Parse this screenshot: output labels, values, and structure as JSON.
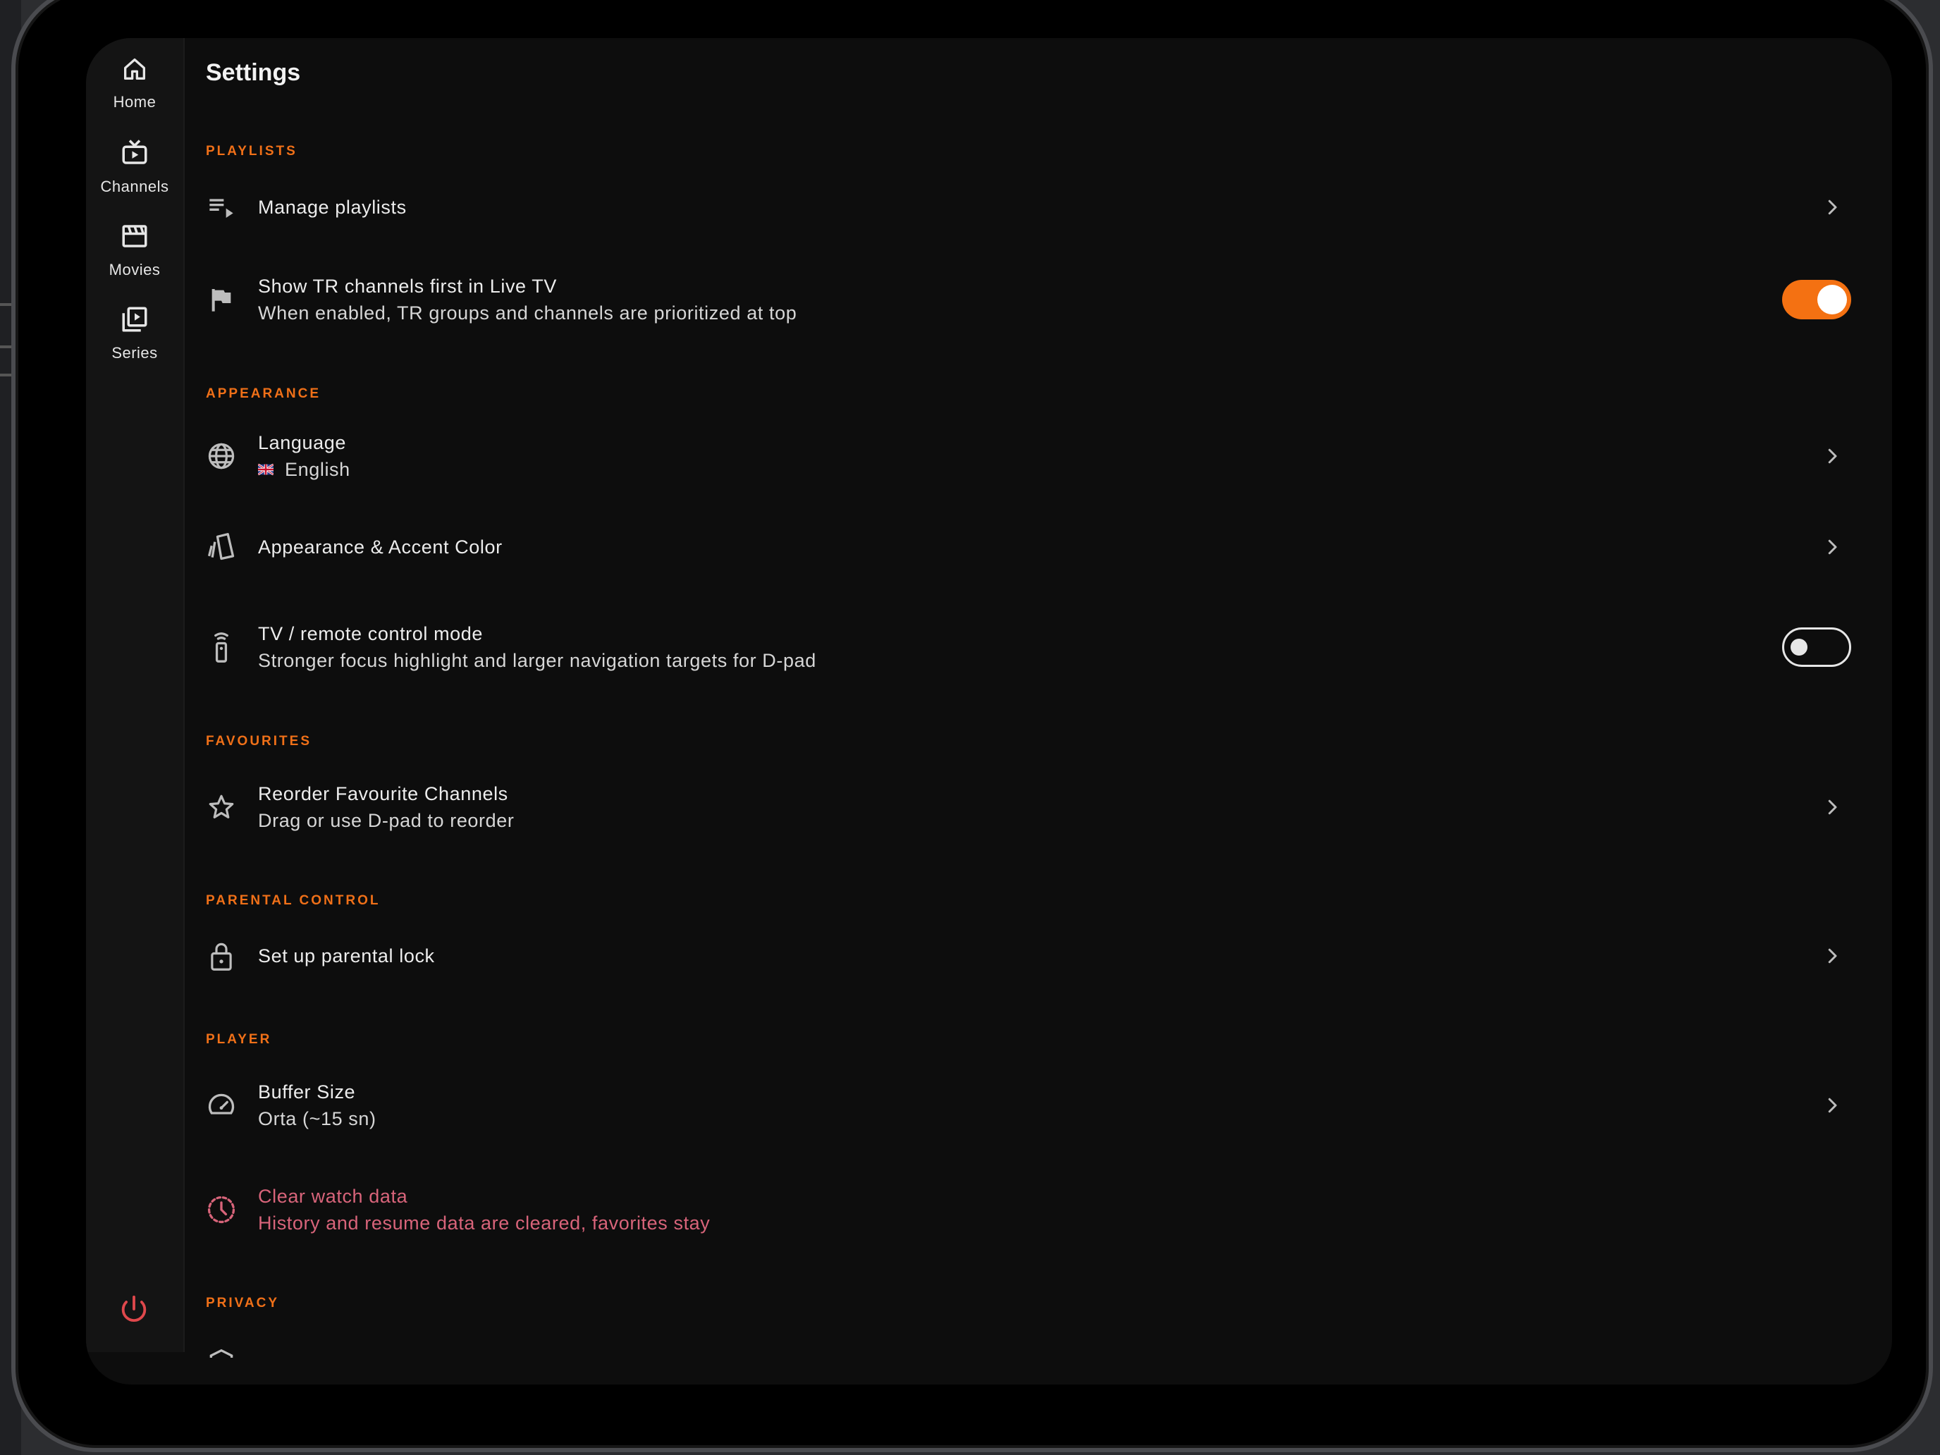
{
  "nav": {
    "items": [
      {
        "label": "Home",
        "icon": "home-icon"
      },
      {
        "label": "Channels",
        "icon": "tv-icon"
      },
      {
        "label": "Movies",
        "icon": "clapperboard-icon"
      },
      {
        "label": "Series",
        "icon": "video-library-icon"
      }
    ],
    "power_icon": "power-icon"
  },
  "page": {
    "title": "Settings"
  },
  "sections": {
    "playlists": {
      "label": "PLAYLISTS",
      "manage": {
        "title": "Manage playlists",
        "icon": "playlist-play-icon"
      },
      "tr_first": {
        "title": "Show TR channels first in Live TV",
        "subtitle": "When enabled, TR groups and channels are prioritized at top",
        "icon": "flag-icon",
        "enabled": true
      }
    },
    "appearance": {
      "label": "APPEARANCE",
      "language": {
        "title": "Language",
        "value": "English",
        "icon": "globe-icon",
        "flag_icon": "uk-flag-icon"
      },
      "accent": {
        "title": "Appearance & Accent Color",
        "icon": "palette-swatch-icon"
      },
      "tv_mode": {
        "title": "TV / remote control mode",
        "subtitle": "Stronger focus highlight and larger navigation targets for D-pad",
        "icon": "remote-icon",
        "enabled": false
      }
    },
    "favourites": {
      "label": "FAVOURITES",
      "reorder": {
        "title": "Reorder Favourite Channels",
        "subtitle": "Drag or use D-pad to reorder",
        "icon": "star-icon"
      }
    },
    "parental": {
      "label": "PARENTAL CONTROL",
      "lock": {
        "title": "Set up parental lock",
        "icon": "lock-icon"
      }
    },
    "player": {
      "label": "PLAYER",
      "buffer": {
        "title": "Buffer Size",
        "subtitle": "Orta (~15 sn)",
        "icon": "speedometer-icon"
      },
      "clear": {
        "title": "Clear watch data",
        "subtitle": "History and resume data are cleared, favorites stay",
        "icon": "history-icon"
      }
    },
    "privacy": {
      "label": "PRIVACY"
    }
  },
  "colors": {
    "accent": "#f47112",
    "section_label": "#f07018",
    "danger": "#d8647a",
    "background": "#0d0d0d",
    "rail": "#141414"
  }
}
